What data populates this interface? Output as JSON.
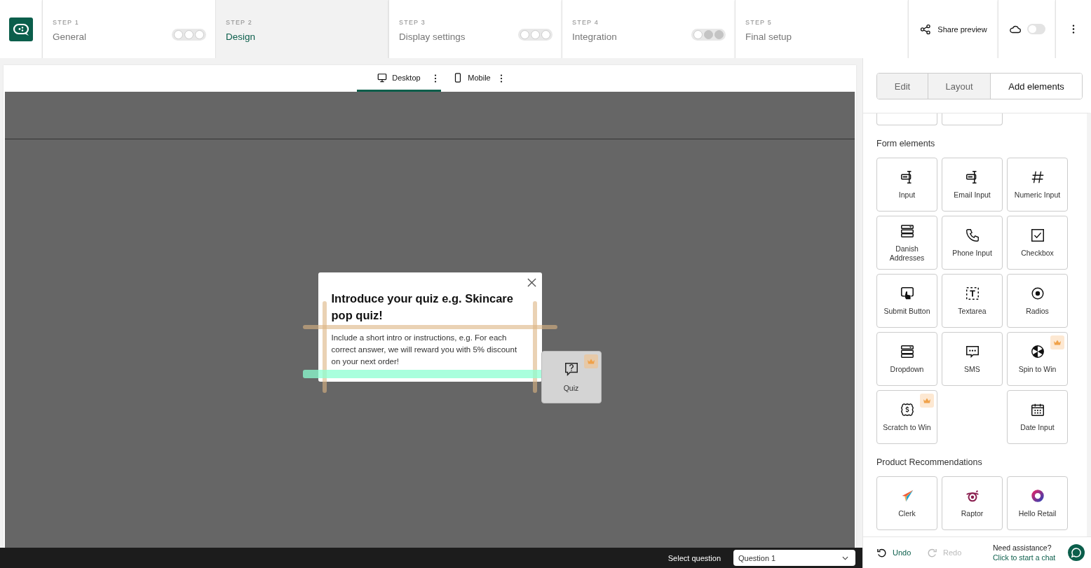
{
  "steps": [
    {
      "label": "STEP 1",
      "name": "General",
      "selected": false,
      "dots": [
        {
          "filled": false
        },
        {
          "filled": false
        },
        {
          "filled": false
        }
      ]
    },
    {
      "label": "STEP 2",
      "name": "Design",
      "selected": true
    },
    {
      "label": "STEP 3",
      "name": "Display settings",
      "selected": false,
      "dots": [
        {
          "filled": false
        },
        {
          "filled": false
        },
        {
          "filled": false
        }
      ]
    },
    {
      "label": "STEP 4",
      "name": "Integration",
      "selected": false,
      "dots": [
        {
          "filled": false
        },
        {
          "filled": true
        },
        {
          "filled": true
        }
      ]
    },
    {
      "label": "STEP 5",
      "name": "Final setup",
      "selected": false
    }
  ],
  "share_preview": "Share preview",
  "autosave_toggle": {
    "on": false
  },
  "device_tabs": [
    {
      "label": "Desktop",
      "kind": "desktop",
      "selected": true
    },
    {
      "label": "Mobile",
      "kind": "mobile",
      "selected": false
    }
  ],
  "popup": {
    "title": "Introduce your quiz e.g. Skincare pop quiz!",
    "body": "Include a short intro or instructions, e.g. For each correct answer, we will reward you with 5% discount on your next order!"
  },
  "dragged_element": {
    "label": "Quiz",
    "kind": "quiz",
    "premium": true
  },
  "question_bar": {
    "label": "Select question",
    "value": "Question 1"
  },
  "panel_tabs": [
    {
      "label": "Edit",
      "selected": false
    },
    {
      "label": "Layout",
      "selected": false
    },
    {
      "label": "Add elements",
      "selected": true
    }
  ],
  "sections": [
    {
      "title": "Form elements",
      "items": [
        {
          "label": "Input",
          "kind": "input",
          "premium": false
        },
        {
          "label": "Email Input",
          "kind": "input",
          "premium": false
        },
        {
          "label": "Numeric Input",
          "kind": "numeric",
          "premium": false
        },
        {
          "label": "Danish Addresses",
          "kind": "dropdown",
          "premium": false
        },
        {
          "label": "Phone Input",
          "kind": "phone",
          "premium": false
        },
        {
          "label": "Checkbox",
          "kind": "checkbox",
          "premium": false
        },
        {
          "label": "Submit Button",
          "kind": "submit",
          "premium": false
        },
        {
          "label": "Textarea",
          "kind": "textarea",
          "premium": false
        },
        {
          "label": "Radios",
          "kind": "radio",
          "premium": false
        },
        {
          "label": "Dropdown",
          "kind": "dropdown",
          "premium": false
        },
        {
          "label": "SMS",
          "kind": "sms",
          "premium": false
        },
        {
          "label": "Spin to Win",
          "kind": "wheel",
          "premium": true
        },
        {
          "label": "Scratch to Win",
          "kind": "scratch",
          "premium": true
        },
        {
          "label": "Date Input",
          "kind": "date",
          "premium": false
        }
      ]
    },
    {
      "title": "Product Recommendations",
      "items": [
        {
          "label": "Clerk",
          "kind": "plane",
          "premium": false
        },
        {
          "label": "Raptor",
          "kind": "eye",
          "premium": false
        },
        {
          "label": "Hello Retail",
          "kind": "ring",
          "premium": false
        }
      ]
    }
  ],
  "footer": {
    "undo": {
      "label": "Undo",
      "disabled": false
    },
    "redo": {
      "label": "Redo",
      "disabled": true
    },
    "help": "Need assistance?",
    "chat_link": "Click to start a chat"
  }
}
